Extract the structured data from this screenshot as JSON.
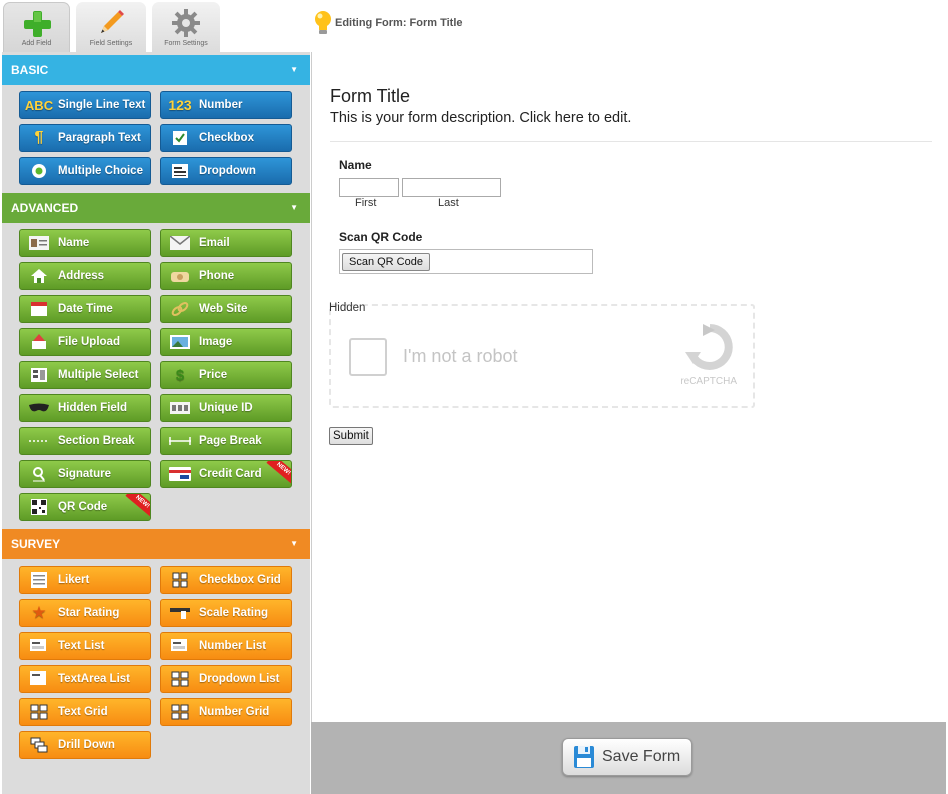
{
  "tabs": [
    {
      "label": "Add Field",
      "icon": "plus-icon"
    },
    {
      "label": "Field Settings",
      "icon": "pencil-icon"
    },
    {
      "label": "Form Settings",
      "icon": "gear-icon"
    }
  ],
  "editing_label": "Editing Form: Form Title",
  "sections": {
    "basic": "BASIC",
    "advanced": "ADVANCED",
    "survey": "SURVEY"
  },
  "basic_fields": [
    "Single Line Text",
    "Number",
    "Paragraph Text",
    "Checkbox",
    "Multiple Choice",
    "Dropdown"
  ],
  "advanced_fields": [
    "Name",
    "Email",
    "Address",
    "Phone",
    "Date Time",
    "Web Site",
    "File Upload",
    "Image",
    "Multiple Select",
    "Price",
    "Hidden Field",
    "Unique ID",
    "Section Break",
    "Page Break",
    "Signature",
    "Credit Card",
    "QR Code"
  ],
  "survey_fields": [
    "Likert",
    "Checkbox Grid",
    "Star Rating",
    "Scale Rating",
    "Text List",
    "Number List",
    "TextArea List",
    "Dropdown List",
    "Text Grid",
    "Number Grid",
    "Drill Down"
  ],
  "new_badge": "NEW!",
  "form": {
    "title": "Form Title",
    "description": "This is your form description. Click here to edit.",
    "name_label": "Name",
    "first_label": "First",
    "last_label": "Last",
    "qr_label": "Scan QR Code",
    "qr_button": "Scan QR Code",
    "hidden_label": "Hidden",
    "captcha_text": "I'm not a robot",
    "captcha_brand": "reCAPTCHA",
    "submit": "Submit"
  },
  "save_button": "Save Form",
  "colors": {
    "basic": "#35b3e3",
    "advanced": "#69aa3a",
    "survey": "#f08a23",
    "footer": "#b3b3b3"
  }
}
